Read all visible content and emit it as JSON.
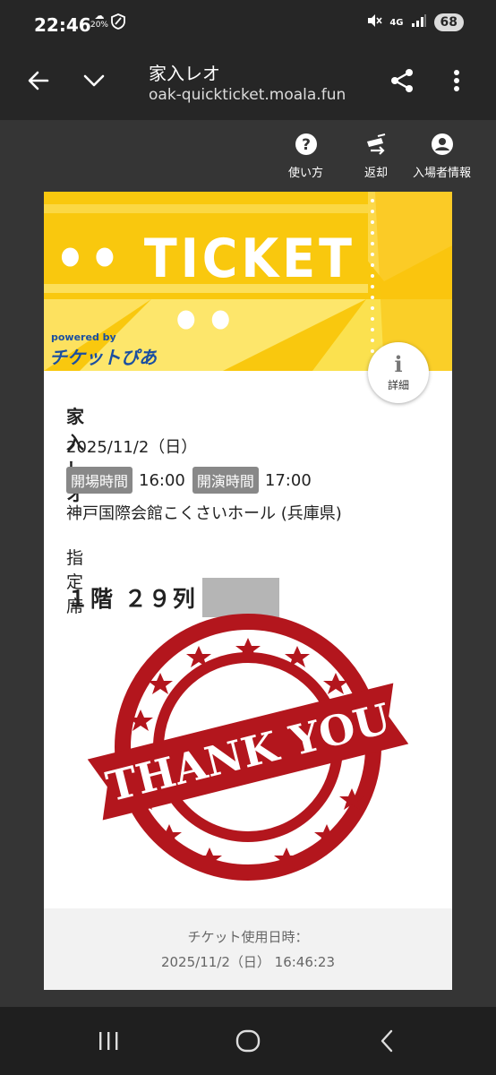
{
  "status_bar": {
    "time": "22:46",
    "data_saver_icon": "data-saver-icon",
    "data_saver_percent": "20%",
    "signal_label": "4G",
    "battery": "68"
  },
  "app_bar": {
    "title": "家入レオ",
    "url": "oak-quickticket.moala.fun"
  },
  "toolbar": {
    "help_label": "使い方",
    "return_label": "返却",
    "attendee_label": "入場者情報"
  },
  "ticket": {
    "banner_title": "•• TICKET ••",
    "logo_small": "powered by",
    "logo_big": "チケットぴあ",
    "detail_label": "詳細",
    "performer": "家入レオ",
    "date": "2025/11/2（日）",
    "open_tag": "開場時間",
    "open_time": "16:00",
    "start_tag": "開演時間",
    "start_time": "17:00",
    "venue": "神戸国際会館こくさいホール (兵庫県)",
    "seat_type": "指定席",
    "seat": "１階 ２９列",
    "stamp_text": "THANK YOU",
    "footer_label": "チケット使用日時：",
    "footer_datetime": "2025/11/2（日） 16:46:23"
  },
  "colors": {
    "banner_yellow": "#f9c80e",
    "banner_light": "#fde66b",
    "stamp_red": "#b3161d",
    "logo_blue": "#1a4fa0"
  }
}
